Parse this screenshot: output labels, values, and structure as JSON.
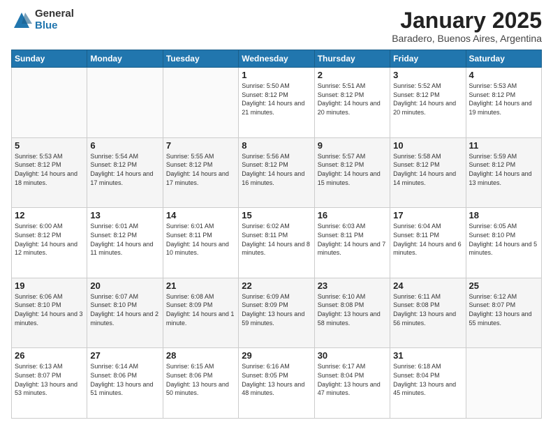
{
  "logo": {
    "general": "General",
    "blue": "Blue"
  },
  "title": {
    "month": "January 2025",
    "location": "Baradero, Buenos Aires, Argentina"
  },
  "weekdays": [
    "Sunday",
    "Monday",
    "Tuesday",
    "Wednesday",
    "Thursday",
    "Friday",
    "Saturday"
  ],
  "weeks": [
    [
      {
        "day": "",
        "info": ""
      },
      {
        "day": "",
        "info": ""
      },
      {
        "day": "",
        "info": ""
      },
      {
        "day": "1",
        "info": "Sunrise: 5:50 AM\nSunset: 8:12 PM\nDaylight: 14 hours and 21 minutes."
      },
      {
        "day": "2",
        "info": "Sunrise: 5:51 AM\nSunset: 8:12 PM\nDaylight: 14 hours and 20 minutes."
      },
      {
        "day": "3",
        "info": "Sunrise: 5:52 AM\nSunset: 8:12 PM\nDaylight: 14 hours and 20 minutes."
      },
      {
        "day": "4",
        "info": "Sunrise: 5:53 AM\nSunset: 8:12 PM\nDaylight: 14 hours and 19 minutes."
      }
    ],
    [
      {
        "day": "5",
        "info": "Sunrise: 5:53 AM\nSunset: 8:12 PM\nDaylight: 14 hours and 18 minutes."
      },
      {
        "day": "6",
        "info": "Sunrise: 5:54 AM\nSunset: 8:12 PM\nDaylight: 14 hours and 17 minutes."
      },
      {
        "day": "7",
        "info": "Sunrise: 5:55 AM\nSunset: 8:12 PM\nDaylight: 14 hours and 17 minutes."
      },
      {
        "day": "8",
        "info": "Sunrise: 5:56 AM\nSunset: 8:12 PM\nDaylight: 14 hours and 16 minutes."
      },
      {
        "day": "9",
        "info": "Sunrise: 5:57 AM\nSunset: 8:12 PM\nDaylight: 14 hours and 15 minutes."
      },
      {
        "day": "10",
        "info": "Sunrise: 5:58 AM\nSunset: 8:12 PM\nDaylight: 14 hours and 14 minutes."
      },
      {
        "day": "11",
        "info": "Sunrise: 5:59 AM\nSunset: 8:12 PM\nDaylight: 14 hours and 13 minutes."
      }
    ],
    [
      {
        "day": "12",
        "info": "Sunrise: 6:00 AM\nSunset: 8:12 PM\nDaylight: 14 hours and 12 minutes."
      },
      {
        "day": "13",
        "info": "Sunrise: 6:01 AM\nSunset: 8:12 PM\nDaylight: 14 hours and 11 minutes."
      },
      {
        "day": "14",
        "info": "Sunrise: 6:01 AM\nSunset: 8:11 PM\nDaylight: 14 hours and 10 minutes."
      },
      {
        "day": "15",
        "info": "Sunrise: 6:02 AM\nSunset: 8:11 PM\nDaylight: 14 hours and 8 minutes."
      },
      {
        "day": "16",
        "info": "Sunrise: 6:03 AM\nSunset: 8:11 PM\nDaylight: 14 hours and 7 minutes."
      },
      {
        "day": "17",
        "info": "Sunrise: 6:04 AM\nSunset: 8:11 PM\nDaylight: 14 hours and 6 minutes."
      },
      {
        "day": "18",
        "info": "Sunrise: 6:05 AM\nSunset: 8:10 PM\nDaylight: 14 hours and 5 minutes."
      }
    ],
    [
      {
        "day": "19",
        "info": "Sunrise: 6:06 AM\nSunset: 8:10 PM\nDaylight: 14 hours and 3 minutes."
      },
      {
        "day": "20",
        "info": "Sunrise: 6:07 AM\nSunset: 8:10 PM\nDaylight: 14 hours and 2 minutes."
      },
      {
        "day": "21",
        "info": "Sunrise: 6:08 AM\nSunset: 8:09 PM\nDaylight: 14 hours and 1 minute."
      },
      {
        "day": "22",
        "info": "Sunrise: 6:09 AM\nSunset: 8:09 PM\nDaylight: 13 hours and 59 minutes."
      },
      {
        "day": "23",
        "info": "Sunrise: 6:10 AM\nSunset: 8:08 PM\nDaylight: 13 hours and 58 minutes."
      },
      {
        "day": "24",
        "info": "Sunrise: 6:11 AM\nSunset: 8:08 PM\nDaylight: 13 hours and 56 minutes."
      },
      {
        "day": "25",
        "info": "Sunrise: 6:12 AM\nSunset: 8:07 PM\nDaylight: 13 hours and 55 minutes."
      }
    ],
    [
      {
        "day": "26",
        "info": "Sunrise: 6:13 AM\nSunset: 8:07 PM\nDaylight: 13 hours and 53 minutes."
      },
      {
        "day": "27",
        "info": "Sunrise: 6:14 AM\nSunset: 8:06 PM\nDaylight: 13 hours and 51 minutes."
      },
      {
        "day": "28",
        "info": "Sunrise: 6:15 AM\nSunset: 8:06 PM\nDaylight: 13 hours and 50 minutes."
      },
      {
        "day": "29",
        "info": "Sunrise: 6:16 AM\nSunset: 8:05 PM\nDaylight: 13 hours and 48 minutes."
      },
      {
        "day": "30",
        "info": "Sunrise: 6:17 AM\nSunset: 8:04 PM\nDaylight: 13 hours and 47 minutes."
      },
      {
        "day": "31",
        "info": "Sunrise: 6:18 AM\nSunset: 8:04 PM\nDaylight: 13 hours and 45 minutes."
      },
      {
        "day": "",
        "info": ""
      }
    ]
  ]
}
